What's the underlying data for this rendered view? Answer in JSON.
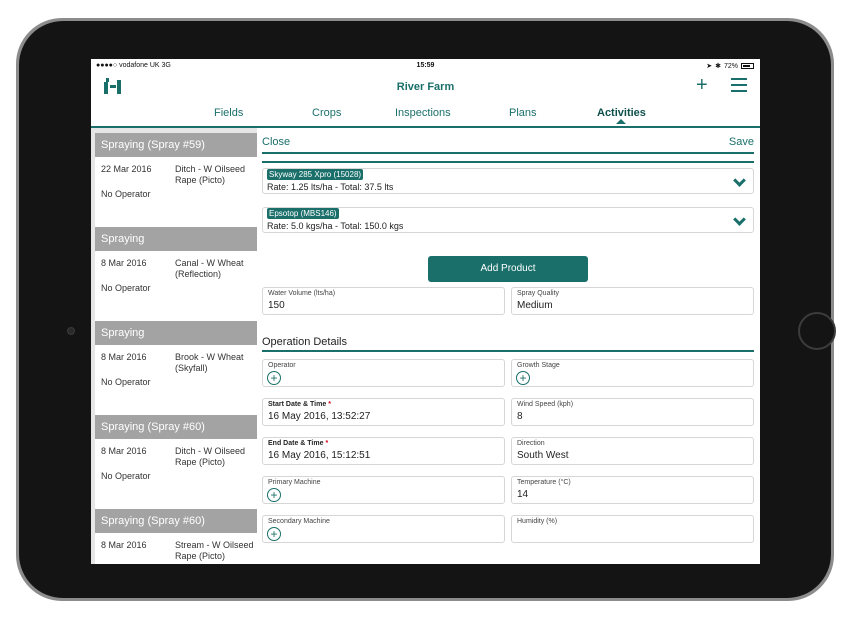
{
  "status_bar": {
    "carrier": "●●●●○ vodafone UK  3G",
    "time": "15:59",
    "battery": "72%"
  },
  "navbar": {
    "title": "River Farm",
    "logo_icon": "farm-logo-icon",
    "add_icon": "plus-icon",
    "menu_icon": "hamburger-menu-icon"
  },
  "tabs": [
    {
      "label": "Fields"
    },
    {
      "label": "Crops"
    },
    {
      "label": "Inspections"
    },
    {
      "label": "Plans"
    },
    {
      "label": "Activities"
    }
  ],
  "activities": [
    {
      "title": "Spraying (Spray #59)",
      "date": "22 Mar 2016",
      "field": "Ditch - W Oilseed Rape (Picto)",
      "operator": "No Operator"
    },
    {
      "title": "Spraying",
      "date": "8 Mar 2016",
      "field": "Canal - W Wheat (Reflection)",
      "operator": "No Operator"
    },
    {
      "title": "Spraying",
      "date": "8 Mar 2016",
      "field": "Brook - W Wheat (Skyfall)",
      "operator": "No Operator"
    },
    {
      "title": "Spraying (Spray #60)",
      "date": "8 Mar 2016",
      "field": "Ditch - W Oilseed Rape (Picto)",
      "operator": "No Operator"
    },
    {
      "title": "Spraying (Spray #60)",
      "date": "8 Mar 2016",
      "field": "Stream - W Oilseed Rape (Picto)",
      "operator": ""
    }
  ],
  "detail": {
    "close_label": "Close",
    "save_label": "Save",
    "products": [
      {
        "name": "Skyway 285 Xpro (15028)",
        "rate": "Rate: 1.25 lts/ha - Total: 37.5 lts"
      },
      {
        "name": "Epsotop (MBS146)",
        "rate": "Rate: 5.0 kgs/ha - Total: 150.0 kgs"
      }
    ],
    "add_product_label": "Add Product",
    "water_volume": {
      "label": "Water Volume (lts/ha)",
      "value": "150"
    },
    "spray_quality": {
      "label": "Spray Quality",
      "value": "Medium"
    },
    "section_title": "Operation Details",
    "operator": {
      "label": "Operator"
    },
    "growth_stage": {
      "label": "Growth Stage"
    },
    "start_date": {
      "label": "Start Date & Time",
      "required": "*",
      "value": "16 May 2016, 13:52:27"
    },
    "wind_speed": {
      "label": "Wind Speed (kph)",
      "value": "8"
    },
    "end_date": {
      "label": "End Date & Time",
      "required": "*",
      "value": "16 May 2016, 15:12:51"
    },
    "direction": {
      "label": "Direction",
      "value": "South West"
    },
    "primary_machine": {
      "label": "Primary Machine"
    },
    "temperature": {
      "label": "Temperature (°C)",
      "value": "14"
    },
    "secondary_machine": {
      "label": "Secondary Machine"
    },
    "humidity": {
      "label": "Humidity (%)",
      "value": ""
    }
  },
  "colors": {
    "accent": "#1a6f6a",
    "list_header": "#a3a3a3",
    "required": "#d0021b"
  }
}
